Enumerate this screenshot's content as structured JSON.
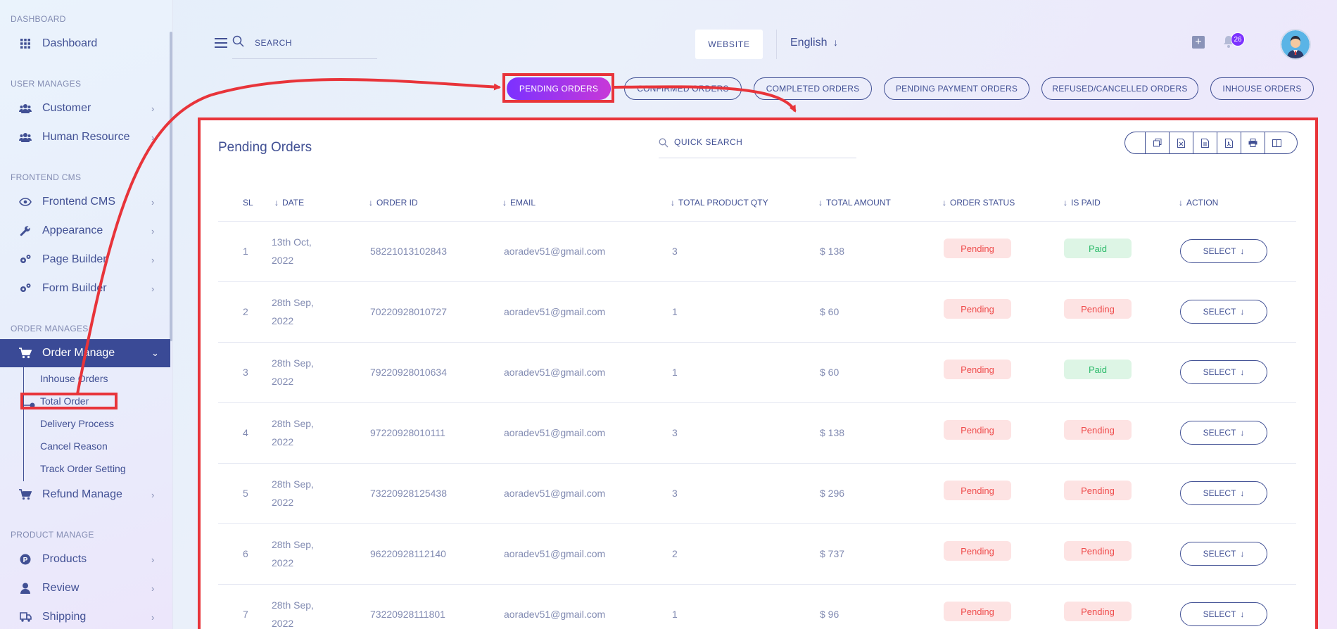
{
  "sidebar": {
    "sections": [
      {
        "title": "DASHBOARD"
      },
      {
        "title": "USER MANAGES"
      },
      {
        "title": "FRONTEND CMS"
      },
      {
        "title": "ORDER MANAGES"
      },
      {
        "title": "PRODUCT MANAGE"
      }
    ],
    "items": {
      "dashboard": "Dashboard",
      "customer": "Customer",
      "human_resource": "Human Resource",
      "frontend_cms": "Frontend CMS",
      "appearance": "Appearance",
      "page_builder": "Page Builder",
      "form_builder": "Form Builder",
      "order_manage": "Order Manage",
      "refund_manage": "Refund Manage",
      "products": "Products",
      "review": "Review",
      "shipping": "Shipping"
    },
    "order_sub": [
      "Inhouse Orders",
      "Total Order",
      "Delivery Process",
      "Cancel Reason",
      "Track Order Setting"
    ]
  },
  "header": {
    "search_placeholder": "SEARCH",
    "website_label": "WEBSITE",
    "language": "English",
    "notification_count": "26"
  },
  "tabs": [
    "PENDING ORDERS",
    "CONFIRMED ORDERS",
    "COMPLETED ORDERS",
    "PENDING PAYMENT ORDERS",
    "REFUSED/CANCELLED ORDERS",
    "INHOUSE ORDERS"
  ],
  "card": {
    "title": "Pending Orders",
    "quick_search": "QUICK SEARCH"
  },
  "table": {
    "columns": [
      "SL",
      "DATE",
      "ORDER ID",
      "EMAIL",
      "TOTAL PRODUCT QTY",
      "TOTAL AMOUNT",
      "ORDER STATUS",
      "IS PAID",
      "ACTION"
    ],
    "rows": [
      {
        "sl": "1",
        "date1": "13th Oct,",
        "date2": "2022",
        "order_id": "58221013102843",
        "email": "aoradev51@gmail.com",
        "qty": "3",
        "amount": "$ 138",
        "status": "Pending",
        "paid": "Paid",
        "action": "SELECT"
      },
      {
        "sl": "2",
        "date1": "28th Sep,",
        "date2": "2022",
        "order_id": "70220928010727",
        "email": "aoradev51@gmail.com",
        "qty": "1",
        "amount": "$ 60",
        "status": "Pending",
        "paid": "Pending",
        "action": "SELECT"
      },
      {
        "sl": "3",
        "date1": "28th Sep,",
        "date2": "2022",
        "order_id": "79220928010634",
        "email": "aoradev51@gmail.com",
        "qty": "1",
        "amount": "$ 60",
        "status": "Pending",
        "paid": "Paid",
        "action": "SELECT"
      },
      {
        "sl": "4",
        "date1": "28th Sep,",
        "date2": "2022",
        "order_id": "97220928010111",
        "email": "aoradev51@gmail.com",
        "qty": "3",
        "amount": "$ 138",
        "status": "Pending",
        "paid": "Pending",
        "action": "SELECT"
      },
      {
        "sl": "5",
        "date1": "28th Sep,",
        "date2": "2022",
        "order_id": "73220928125438",
        "email": "aoradev51@gmail.com",
        "qty": "3",
        "amount": "$ 296",
        "status": "Pending",
        "paid": "Pending",
        "action": "SELECT"
      },
      {
        "sl": "6",
        "date1": "28th Sep,",
        "date2": "2022",
        "order_id": "96220928112140",
        "email": "aoradev51@gmail.com",
        "qty": "2",
        "amount": "$ 737",
        "status": "Pending",
        "paid": "Pending",
        "action": "SELECT"
      },
      {
        "sl": "7",
        "date1": "28th Sep,",
        "date2": "2022",
        "order_id": "73220928111801",
        "email": "aoradev51@gmail.com",
        "qty": "1",
        "amount": "$ 96",
        "status": "Pending",
        "paid": "Pending",
        "action": "SELECT"
      }
    ]
  },
  "colors": {
    "primary": "#415094",
    "accent_purple": "#7c32ff",
    "annotation_red": "#e8343a",
    "pending_bg": "#fde3e3",
    "paid_bg": "#ddf5e5"
  }
}
